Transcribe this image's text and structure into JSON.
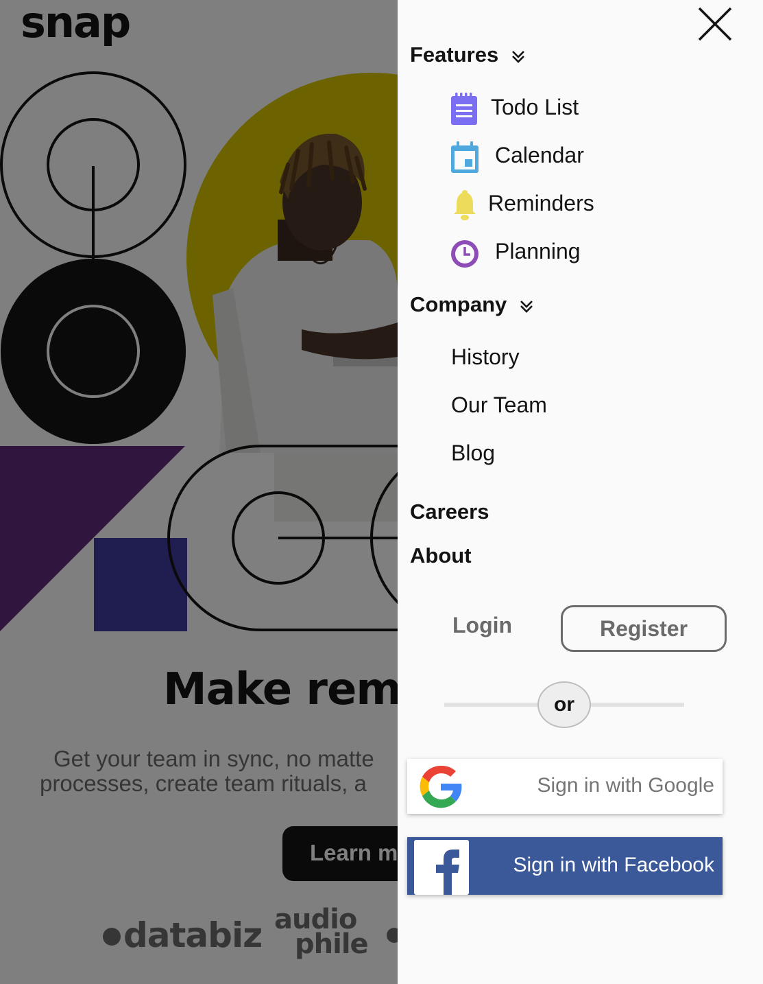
{
  "brand": {
    "logo_text": "snap"
  },
  "hero": {
    "title": "Make remo",
    "subtitle_line1": "Get your team in sync, no matte",
    "subtitle_line2": "processes, create team rituals, a",
    "cta_label": "Learn m"
  },
  "clients": {
    "databiz": "databiz",
    "audiophile_line1": "audio",
    "audiophile_line2": "phile"
  },
  "colors": {
    "purple_accent": "#7c6ef2",
    "calendar_blue": "#4fa9de",
    "bell_yellow": "#eddc5b",
    "planning_purple": "#8e4cb7",
    "facebook_blue": "#3b5998",
    "muted_text": "#6b6b6b"
  },
  "menu": {
    "close_icon": "close-x-icon",
    "features": {
      "label": "Features",
      "items": [
        {
          "label": "Todo List",
          "icon": "todo-list-icon"
        },
        {
          "label": "Calendar",
          "icon": "calendar-icon"
        },
        {
          "label": "Reminders",
          "icon": "bell-icon"
        },
        {
          "label": "Planning",
          "icon": "clock-icon"
        }
      ]
    },
    "company": {
      "label": "Company",
      "items": [
        {
          "label": "History"
        },
        {
          "label": "Our Team"
        },
        {
          "label": "Blog"
        }
      ]
    },
    "careers": "Careers",
    "about": "About"
  },
  "auth": {
    "login": "Login",
    "register": "Register",
    "divider": "or",
    "google": "Sign in with Google",
    "facebook": "Sign in with Facebook"
  }
}
